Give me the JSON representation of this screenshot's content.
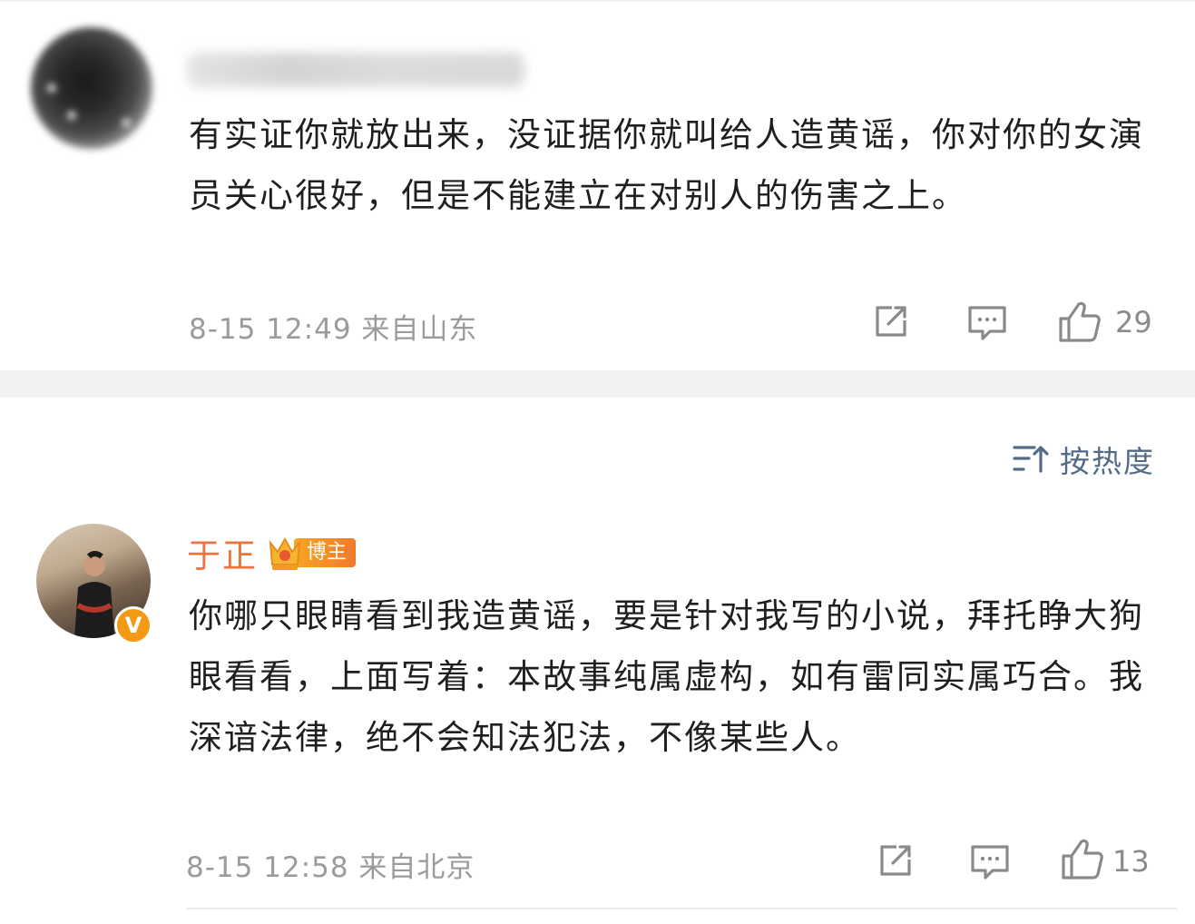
{
  "comments": [
    {
      "username": "",
      "text": "有实证你就放出来，没证据你就叫给人造黄谣，你对你的女演员关心很好，但是不能建立在对别人的伤害之上。",
      "meta": "8-15 12:49 来自山东",
      "like_count": "29"
    },
    {
      "username": "于正",
      "badge": "博主",
      "text": "你哪只眼睛看到我造黄谣，要是针对我写的小说，拜托睁大狗眼看看，上面写着：本故事纯属虚构，如有雷同实属巧合。我深谙法律，绝不会知法犯法，不像某些人。",
      "meta": "8-15 12:58 来自北京",
      "like_count": "13"
    }
  ],
  "sort": {
    "label": "按热度"
  },
  "icons": {
    "share": "share-icon",
    "comment": "comment-icon",
    "like": "thumbs-up-icon",
    "sort": "sort-icon",
    "verified": "verified-v-icon",
    "crown": "crown-icon"
  },
  "colors": {
    "author_name": "#eb7340",
    "sort_label": "#536b86",
    "meta_text": "#9b9b9b",
    "separator": "#f2f2f2",
    "verified_badge": "#f29a13"
  }
}
